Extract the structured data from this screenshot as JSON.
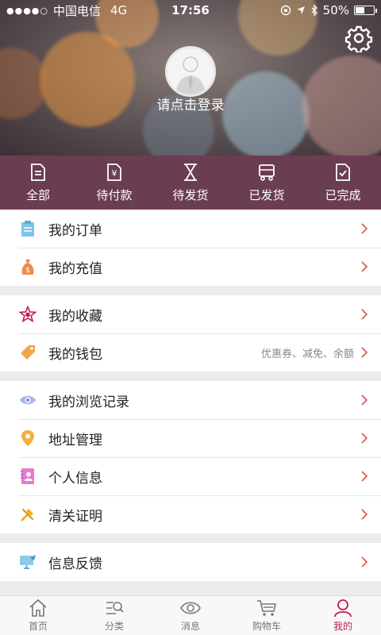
{
  "status_bar": {
    "carrier": "中国电信",
    "network": "4G",
    "time": "17:56",
    "battery": "50%",
    "battery_level": 0.5
  },
  "profile": {
    "login_prompt": "请点击登录"
  },
  "order_bar": {
    "items": [
      {
        "label": "全部",
        "icon": "document-icon"
      },
      {
        "label": "待付款",
        "icon": "payment-icon"
      },
      {
        "label": "待发货",
        "icon": "hourglass-icon"
      },
      {
        "label": "已发货",
        "icon": "truck-icon"
      },
      {
        "label": "已完成",
        "icon": "checked-document-icon"
      }
    ]
  },
  "menu": {
    "my_orders": "我的订单",
    "my_recharge": "我的充值",
    "my_favorites": "我的收藏",
    "my_wallet": "我的钱包",
    "wallet_note": "优惠券、减免、余额",
    "browse_history": "我的浏览记录",
    "address_management": "地址管理",
    "personal_info": "个人信息",
    "customs_clearance": "清关证明",
    "feedback": "信息反馈"
  },
  "tab_bar": {
    "items": [
      {
        "label": "首页",
        "icon": "home-icon"
      },
      {
        "label": "分类",
        "icon": "category-search-icon"
      },
      {
        "label": "消息",
        "icon": "eye-icon"
      },
      {
        "label": "购物车",
        "icon": "cart-icon"
      },
      {
        "label": "我的",
        "icon": "user-icon",
        "active": true
      }
    ]
  },
  "colors": {
    "order_bar_bg": "#6b3d52",
    "accent": "#c2185b",
    "chevron": "#e0504f"
  }
}
